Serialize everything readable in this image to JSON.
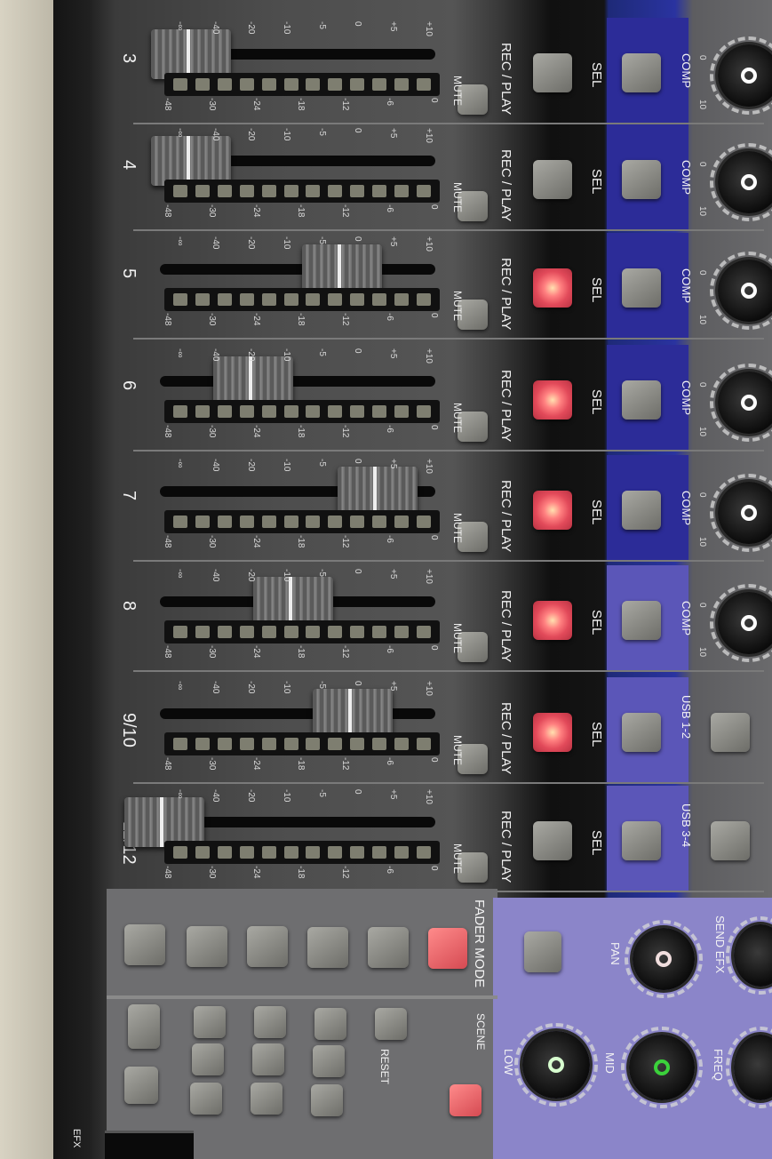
{
  "channels": [
    {
      "number": "3",
      "rec_play": "REC / PLAY",
      "sel": "SEL",
      "mute": "MUTE",
      "comp": "COMP",
      "lit": false
    },
    {
      "number": "4",
      "rec_play": "REC / PLAY",
      "sel": "SEL",
      "mute": "MUTE",
      "comp": "COMP",
      "lit": false
    },
    {
      "number": "5",
      "rec_play": "REC / PLAY",
      "sel": "SEL",
      "mute": "MUTE",
      "comp": "COMP",
      "lit": true
    },
    {
      "number": "6",
      "rec_play": "REC / PLAY",
      "sel": "SEL",
      "mute": "MUTE",
      "comp": "COMP",
      "lit": true
    },
    {
      "number": "7",
      "rec_play": "REC / PLAY",
      "sel": "SEL",
      "mute": "MUTE",
      "comp": "COMP",
      "lit": true
    },
    {
      "number": "8",
      "rec_play": "REC / PLAY",
      "sel": "SEL",
      "mute": "MUTE",
      "comp": "COMP",
      "lit": true
    },
    {
      "number": "9/10",
      "rec_play": "REC / PLAY",
      "sel": "SEL",
      "mute": "MUTE",
      "usb": "USB 1-2",
      "lit": true
    },
    {
      "number": "11/12",
      "rec_play": "REC / PLAY",
      "sel": "SEL",
      "mute": "MUTE",
      "usb": "USB 3-4",
      "lit": false
    }
  ],
  "fader_scale": [
    "+10",
    "+5",
    "0",
    "-5",
    "-10",
    "-20",
    "-40",
    "-∞"
  ],
  "meter_scale": [
    "0",
    "-6",
    "-12",
    "-18",
    "-24",
    "-30",
    "-48"
  ],
  "comp_scale": [
    "0",
    "10"
  ],
  "sections": {
    "fader_mode": "FADER MODE",
    "scene": "SCENE",
    "reset": "RESET",
    "pan": "PAN",
    "send_efx": "SEND EFX",
    "freq": "FREQ",
    "low": "LOW",
    "mid": "MID",
    "efx": "EFX"
  },
  "colors": {
    "blue_strip": "#2c2c98",
    "lavender_panel": "#8b85c9",
    "rec_lit": "#ff7a7a",
    "fader_mode_button": "#e05a60"
  }
}
